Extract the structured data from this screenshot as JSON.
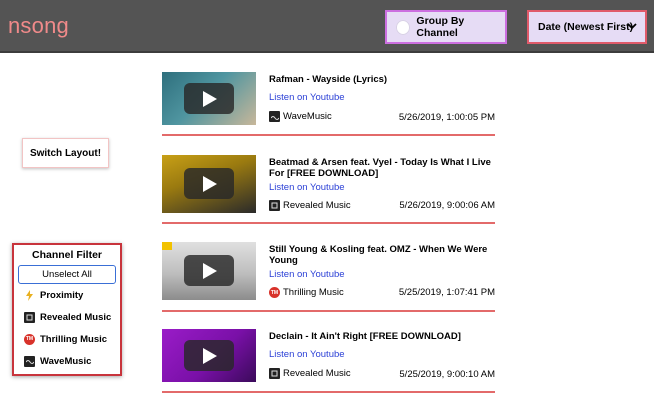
{
  "header": {
    "brand": "nsong",
    "group_label": "Group By Channel",
    "sort_label": "Date (Newest First)",
    "sort_chevron": "⌄"
  },
  "switch_layout_label": "Switch Layout!",
  "filter": {
    "title": "Channel Filter",
    "unselect_label": "Unselect All",
    "items": [
      {
        "label": "Proximity",
        "icon": "lightning-icon"
      },
      {
        "label": "Revealed Music",
        "icon": "revealed-music-icon"
      },
      {
        "label": "Thrilling Music",
        "icon": "thrilling-music-icon"
      },
      {
        "label": "WaveMusic",
        "icon": "wavemusic-icon"
      }
    ]
  },
  "cards": [
    {
      "title": "Rafman - Wayside (Lyrics)",
      "link": "Listen on Youtube",
      "channel": "WaveMusic",
      "date": "5/26/2019, 1:00:05 PM",
      "thumb_colors": [
        "#3a7d8a",
        "#c9b89a"
      ]
    },
    {
      "title": "Beatmad & Arsen feat. Vyel - Today Is What I Live For [FREE DOWNLOAD]",
      "link": "Listen on Youtube",
      "channel": "Revealed Music",
      "date": "5/26/2019, 9:00:06 AM",
      "thumb_colors": [
        "#c99a14",
        "#2a2a2a"
      ]
    },
    {
      "title": "Still Young & Kosling feat. OMZ - When We Were Young",
      "link": "Listen on Youtube",
      "channel": "Thrilling Music",
      "date": "5/25/2019, 1:07:41 PM",
      "thumb_colors": [
        "#d9d9d9",
        "#8a8a8a"
      ]
    },
    {
      "title": "Declain - It Ain't Right [FREE DOWNLOAD]",
      "link": "Listen on Youtube",
      "channel": "Revealed Music",
      "date": "5/25/2019, 9:00:10 AM",
      "thumb_colors": [
        "#8a18b8",
        "#3a0a5a"
      ]
    }
  ]
}
